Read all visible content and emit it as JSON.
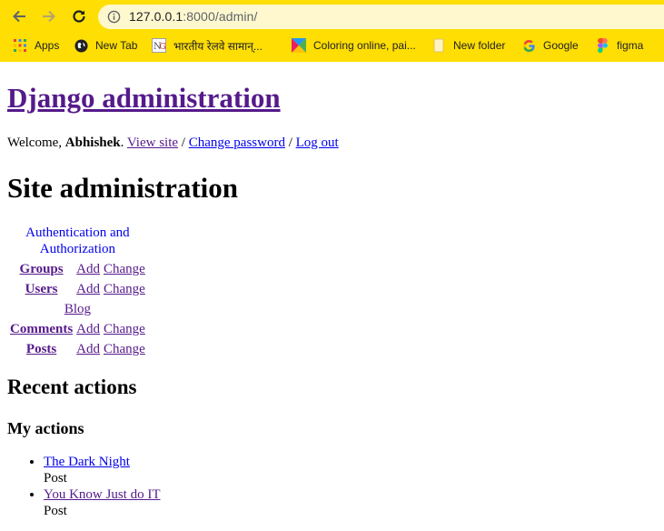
{
  "browser": {
    "url_host": "127.0.0.1",
    "url_rest": ":8000/admin/",
    "bookmarks": [
      {
        "label": "Apps",
        "icon": "apps-grid-icon"
      },
      {
        "label": "New Tab",
        "icon": "globe-icon"
      },
      {
        "label": "भारतीय रेलवे सामान्...",
        "icon": "site-favicon-icon"
      },
      {
        "label": "Coloring online, pai...",
        "icon": "coloring-favicon-icon"
      },
      {
        "label": "New folder",
        "icon": "folder-icon"
      },
      {
        "label": "Google",
        "icon": "google-icon"
      },
      {
        "label": "figma",
        "icon": "figma-icon"
      }
    ]
  },
  "header": {
    "site_name": "Django administration",
    "welcome": "Welcome, ",
    "username": "Abhishek",
    "after_user": ". ",
    "view_site": "View site",
    "sep": " / ",
    "change_password": "Change password",
    "log_out": "Log out"
  },
  "content": {
    "title": "Site administration",
    "apps": [
      {
        "name": "Authentication and Authorization",
        "models": [
          {
            "name": "Groups",
            "add": "Add",
            "change": "Change"
          },
          {
            "name": "Users",
            "add": "Add",
            "change": "Change"
          }
        ]
      },
      {
        "name": "Blog",
        "models": [
          {
            "name": "Comments",
            "add": "Add",
            "change": "Change"
          },
          {
            "name": "Posts",
            "add": "Add",
            "change": "Change"
          }
        ]
      }
    ]
  },
  "sidebar": {
    "recent_title": "Recent actions",
    "my_actions": "My actions",
    "actions": [
      {
        "title": "The Dark Night",
        "type": "Post"
      },
      {
        "title": "You Know Just do IT",
        "type": "Post"
      }
    ]
  }
}
